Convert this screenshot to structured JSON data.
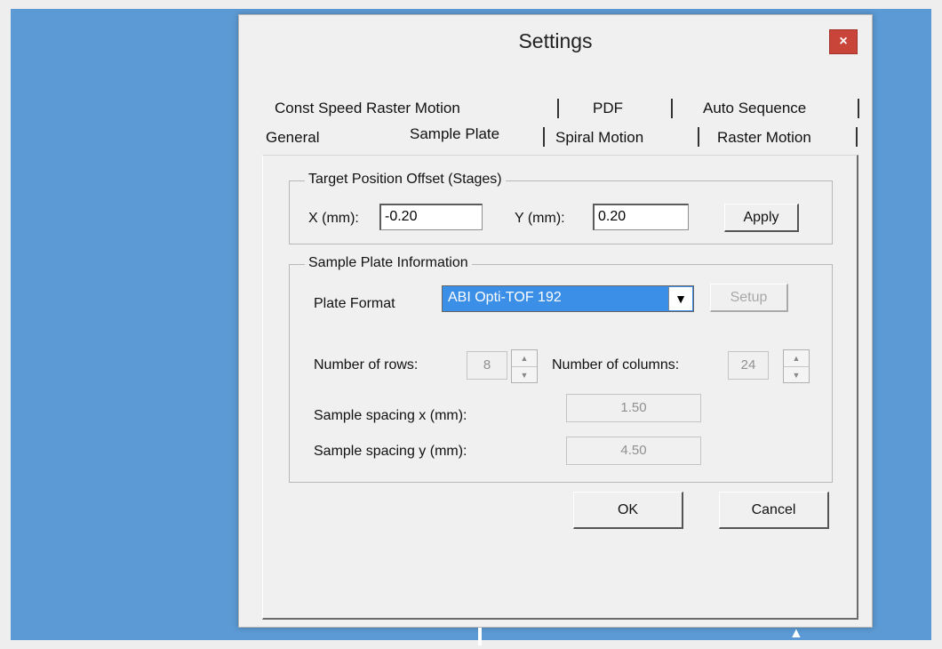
{
  "window": {
    "title": "Settings",
    "close_label": "×"
  },
  "tabs": {
    "row1": [
      "Const Speed Raster Motion",
      "PDF",
      "Auto Sequence"
    ],
    "row2": [
      "General",
      "Sample Plate",
      "Spiral Motion",
      "Raster Motion"
    ],
    "active": "Sample Plate"
  },
  "target_offset": {
    "title": "Target Position Offset (Stages)",
    "x_label": "X (mm):",
    "x_value": "-0.20",
    "y_label": "Y (mm):",
    "y_value": "0.20",
    "apply_label": "Apply"
  },
  "sample_plate": {
    "title": "Sample Plate Information",
    "format_label": "Plate Format",
    "format_value": "ABI Opti-TOF 192",
    "setup_label": "Setup",
    "rows_label": "Number of rows:",
    "rows_value": "8",
    "cols_label": "Number of columns:",
    "cols_value": "24",
    "spacing_x_label": "Sample spacing x (mm):",
    "spacing_x_value": "1.50",
    "spacing_y_label": "Sample spacing y (mm):",
    "spacing_y_value": "4.50"
  },
  "footer": {
    "ok_label": "OK",
    "cancel_label": "Cancel"
  },
  "colors": {
    "desktop": "#5b9ad4",
    "close": "#c9453a",
    "selection": "#3c8fe6"
  }
}
